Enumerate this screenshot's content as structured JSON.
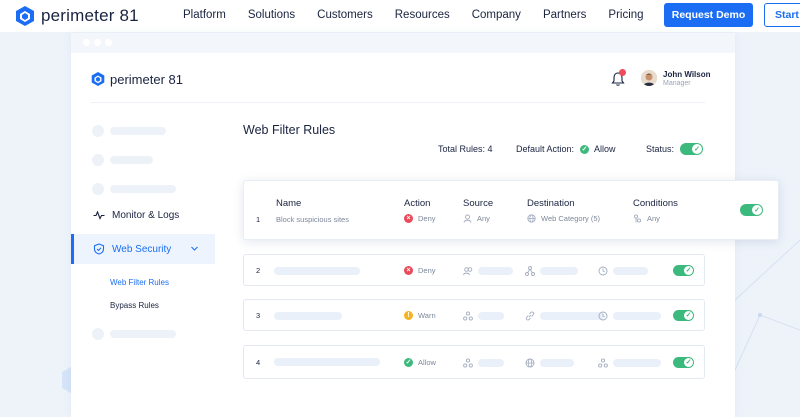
{
  "site": {
    "brand": "perimeter 81",
    "nav": [
      "Platform",
      "Solutions",
      "Customers",
      "Resources",
      "Company",
      "Partners",
      "Pricing"
    ],
    "request_demo": "Request Demo",
    "start": "Start"
  },
  "app": {
    "brand": "perimeter 81",
    "user": {
      "name": "John Wilson",
      "role": "Manager"
    },
    "sidebar": {
      "monitor_logs": "Monitor & Logs",
      "web_security": "Web Security",
      "sub_items": [
        "Web Filter Rules",
        "Bypass Rules"
      ]
    },
    "page_title": "Web Filter Rules",
    "summary": {
      "total_rules": "Total Rules: 4",
      "default_action_label": "Default Action:",
      "default_action_value": "Allow",
      "status_label": "Status:"
    },
    "columns": {
      "name": "Name",
      "action": "Action",
      "source": "Source",
      "destination": "Destination",
      "conditions": "Conditions"
    },
    "rules": [
      {
        "index": "1",
        "name": "Block suspicious sites",
        "action": "Deny",
        "source": "Any",
        "destination": "Web Category (5)",
        "conditions": "Any",
        "enabled": true
      },
      {
        "index": "2",
        "action": "Deny",
        "enabled": true
      },
      {
        "index": "3",
        "action": "Warn",
        "enabled": true
      },
      {
        "index": "4",
        "action": "Allow",
        "enabled": true
      }
    ]
  },
  "colors": {
    "primary": "#1b6ef3",
    "allow": "#3cb97c",
    "deny": "#ea4b5a",
    "warn": "#f5b325"
  }
}
